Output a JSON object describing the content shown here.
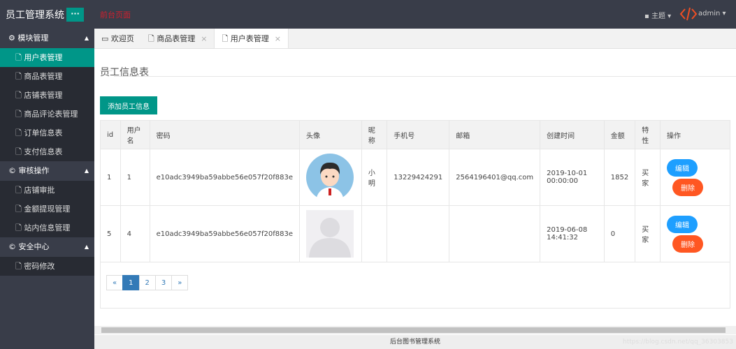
{
  "header": {
    "title": "员工管理系统",
    "menu_label": "···",
    "front_link": "前台页面",
    "theme_label": "主题 ▾",
    "user_label": "admin ▾"
  },
  "sidebar": {
    "groups": [
      {
        "label": "模块管理",
        "items": [
          "用户表管理",
          "商品表管理",
          "店铺表管理",
          "商品评论表管理",
          "订单信息表",
          "支付信息表"
        ]
      },
      {
        "label": "审核操作",
        "items": [
          "店铺审批",
          "金额提现管理",
          "站内信息管理"
        ]
      },
      {
        "label": "安全中心",
        "items": [
          "密码修改"
        ]
      }
    ]
  },
  "tabs": [
    {
      "label": "欢迎页"
    },
    {
      "label": "商品表管理"
    },
    {
      "label": "用户表管理"
    }
  ],
  "tab_close": "×",
  "page": {
    "legend": "员工信息表",
    "add_button": "添加员工信息"
  },
  "table": {
    "headers": [
      "id",
      "用户名",
      "密码",
      "头像",
      "昵称",
      "手机号",
      "邮箱",
      "创建时间",
      "金额",
      "特性",
      "操作"
    ],
    "rows": [
      {
        "id": "1",
        "username": "1",
        "password": "e10adc3949ba59abbe56e057f20f883e",
        "nickname": "小明",
        "phone": "13229424291",
        "email": "2564196401@qq.com",
        "created": "2019-10-01 00:00:00",
        "amount": "1852",
        "trait": "买家"
      },
      {
        "id": "5",
        "username": "4",
        "password": "e10adc3949ba59abbe56e057f20f883e",
        "nickname": "",
        "phone": "",
        "email": "",
        "created": "2019-06-08 14:41:32",
        "amount": "0",
        "trait": "买家"
      }
    ],
    "edit_label": "编辑",
    "delete_label": "删除"
  },
  "pagination": {
    "prev": "«",
    "pages": [
      "1",
      "2",
      "3"
    ],
    "next": "»",
    "current": "1"
  },
  "footer": {
    "text": "后台图书管理系统",
    "watermark": "https://blog.csdn.net/qq_36303853"
  }
}
